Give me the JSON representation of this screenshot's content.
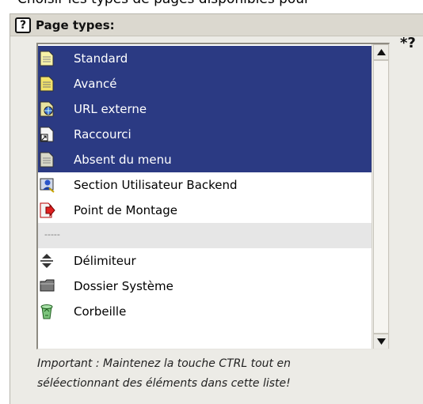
{
  "top_text": "Choisir les types de pages disponibles pour",
  "field": {
    "label": "Page types:",
    "help_icon": "help-icon",
    "required_icon": "pointer-icon"
  },
  "listbox": {
    "options": [
      {
        "label": "Standard",
        "icon": "page-icon",
        "selected": true
      },
      {
        "label": "Avancé",
        "icon": "page-advanced-icon",
        "selected": true
      },
      {
        "label": "URL externe",
        "icon": "external-url-icon",
        "selected": true
      },
      {
        "label": "Raccourci",
        "icon": "shortcut-icon",
        "selected": true
      },
      {
        "label": "Absent du menu",
        "icon": "page-hidden-icon",
        "selected": true
      },
      {
        "label": "Section Utilisateur Backend",
        "icon": "backend-user-icon",
        "selected": false
      },
      {
        "label": "Point de Montage",
        "icon": "mount-point-icon",
        "selected": false
      },
      {
        "label": "-----",
        "icon": "",
        "selected": false,
        "divider": true
      },
      {
        "label": "Délimiteur",
        "icon": "spacer-icon",
        "selected": false
      },
      {
        "label": "Dossier Système",
        "icon": "sysfolder-icon",
        "selected": false
      },
      {
        "label": "Corbeille",
        "icon": "recycler-icon",
        "selected": false
      }
    ]
  },
  "note_line1": "Important : Maintenez la touche CTRL tout en",
  "note_line2": "séléectionnant des éléments dans cette liste!",
  "colors": {
    "selection": "#2b3a83",
    "panel": "#ecebe6"
  }
}
